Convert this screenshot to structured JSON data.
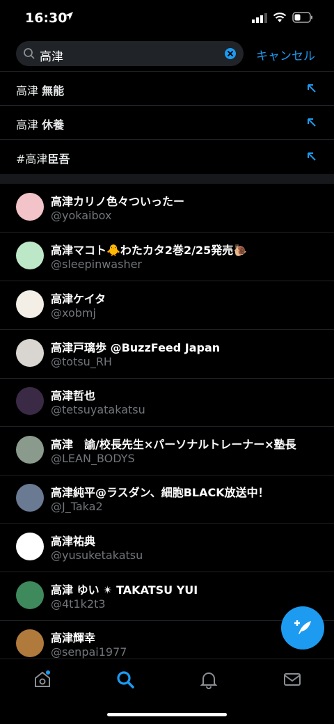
{
  "status": {
    "time": "16:30"
  },
  "search": {
    "query": "高津",
    "cancel": "キャンセル"
  },
  "suggestions": [
    {
      "prefix": "高津",
      "bold": "無能"
    },
    {
      "prefix": "高津",
      "bold": "休養"
    },
    {
      "prefix": "#高津",
      "bold": "臣吾"
    }
  ],
  "users": [
    {
      "name": "高津カリノ色々ついったー",
      "handle": "@yokaibox",
      "avatar_color": "#f2c3c8"
    },
    {
      "name": "高津マコト🐥わたカタ2巻2/25発売🐌",
      "handle": "@sleepinwasher",
      "avatar_color": "#bde8c8"
    },
    {
      "name": "高津ケイタ",
      "handle": "@xobmj",
      "avatar_color": "#f3efe6"
    },
    {
      "name": "高津戸璃歩 @BuzzFeed Japan",
      "handle": "@totsu_RH",
      "avatar_color": "#d9d5d0"
    },
    {
      "name": "高津哲也",
      "handle": "@tetsuyatakatsu",
      "avatar_color": "#3b2a46"
    },
    {
      "name": "高津　諭/校長先生×パーソナルトレーナー×塾長",
      "handle": "@LEAN_BODYS",
      "avatar_color": "#8a9a8c"
    },
    {
      "name": "高津純平@ラスダン、細胞BLACK放送中！",
      "handle": "@J_Taka2",
      "avatar_color": "#6a7a93"
    },
    {
      "name": "高津祐典",
      "handle": "@yusuketakatsu",
      "avatar_color": "#ffffff"
    },
    {
      "name": "高津 ゆい ✴︎ TAKATSU YUI",
      "handle": "@4t1k2t3",
      "avatar_color": "#3f8a5c"
    },
    {
      "name": "高津輝幸",
      "handle": "@senpai1977",
      "avatar_color": "#b07a3c"
    }
  ],
  "colors": {
    "accent": "#1d9bf0",
    "background": "#000000",
    "secondary_text": "#71767b"
  },
  "tabs": [
    "home-icon",
    "search-icon",
    "bell-icon",
    "mail-icon"
  ]
}
